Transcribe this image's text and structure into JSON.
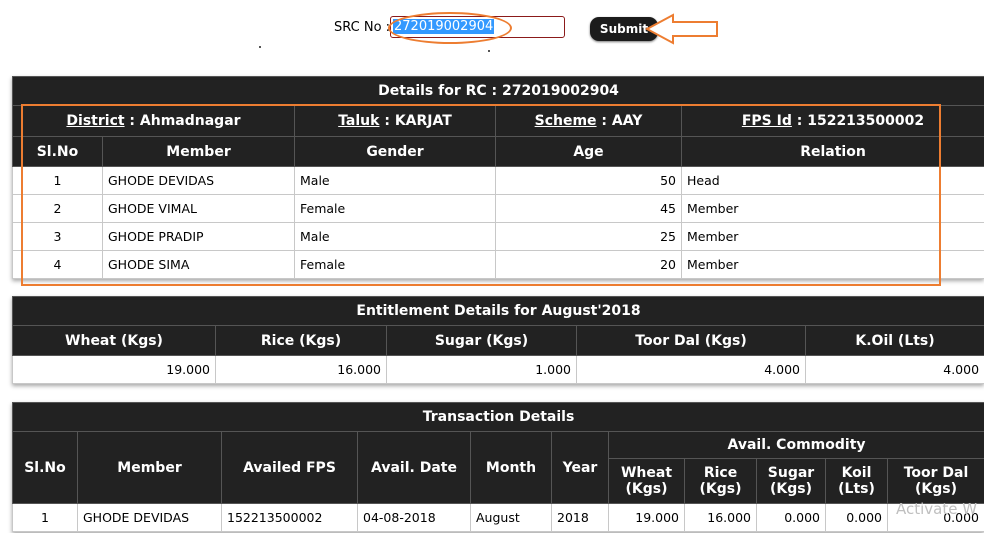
{
  "search": {
    "label": "SRC No :",
    "value": "272019002904",
    "submit_label": "Submit"
  },
  "details": {
    "title": "Details for RC : 272019002904",
    "district_label": "District",
    "district_value": " : Ahmadnagar",
    "taluk_label": "Taluk",
    "taluk_value": " : KARJAT",
    "scheme_label": "Scheme",
    "scheme_value": " : AAY",
    "fps_label": "FPS Id",
    "fps_value": " : 152213500002",
    "columns": [
      "Sl.No",
      "Member",
      "Gender",
      "Age",
      "Relation"
    ],
    "rows": [
      {
        "slno": "1",
        "member": "GHODE DEVIDAS",
        "gender": "Male",
        "age": "50",
        "relation": "Head"
      },
      {
        "slno": "2",
        "member": "GHODE VIMAL",
        "gender": "Female",
        "age": "45",
        "relation": "Member"
      },
      {
        "slno": "3",
        "member": "GHODE PRADIP",
        "gender": "Male",
        "age": "25",
        "relation": "Member"
      },
      {
        "slno": "4",
        "member": "GHODE SIMA",
        "gender": "Female",
        "age": "20",
        "relation": "Member"
      }
    ]
  },
  "entitlement": {
    "title": "Entitlement Details for August'2018",
    "columns": [
      "Wheat (Kgs)",
      "Rice (Kgs)",
      "Sugar (Kgs)",
      "Toor Dal (Kgs)",
      "K.Oil (Lts)"
    ],
    "values": [
      "19.000",
      "16.000",
      "1.000",
      "4.000",
      "4.000"
    ]
  },
  "transactions": {
    "title": "Transaction Details",
    "columns": {
      "slno": "Sl.No",
      "member": "Member",
      "availed_fps": "Availed FPS",
      "avail_date": "Avail. Date",
      "month": "Month",
      "year": "Year",
      "avail_commodity": "Avail. Commodity",
      "wheat": "Wheat (Kgs)",
      "rice": "Rice (Kgs)",
      "sugar": "Sugar (Kgs)",
      "koil": "Koil (Lts)",
      "toordal": "Toor Dal (Kgs)"
    },
    "rows": [
      {
        "slno": "1",
        "member": "GHODE DEVIDAS",
        "fps": "152213500002",
        "date": "04-08-2018",
        "month": "August",
        "year": "2018",
        "wheat": "19.000",
        "rice": "16.000",
        "sugar": "0.000",
        "koil": "0.000",
        "toordal": "0.000"
      }
    ]
  },
  "overlay": {
    "watermark": "Activate W"
  },
  "colors": {
    "header_bg": "#222222",
    "annotation": "#ed7d31",
    "selection": "#3399ff"
  }
}
